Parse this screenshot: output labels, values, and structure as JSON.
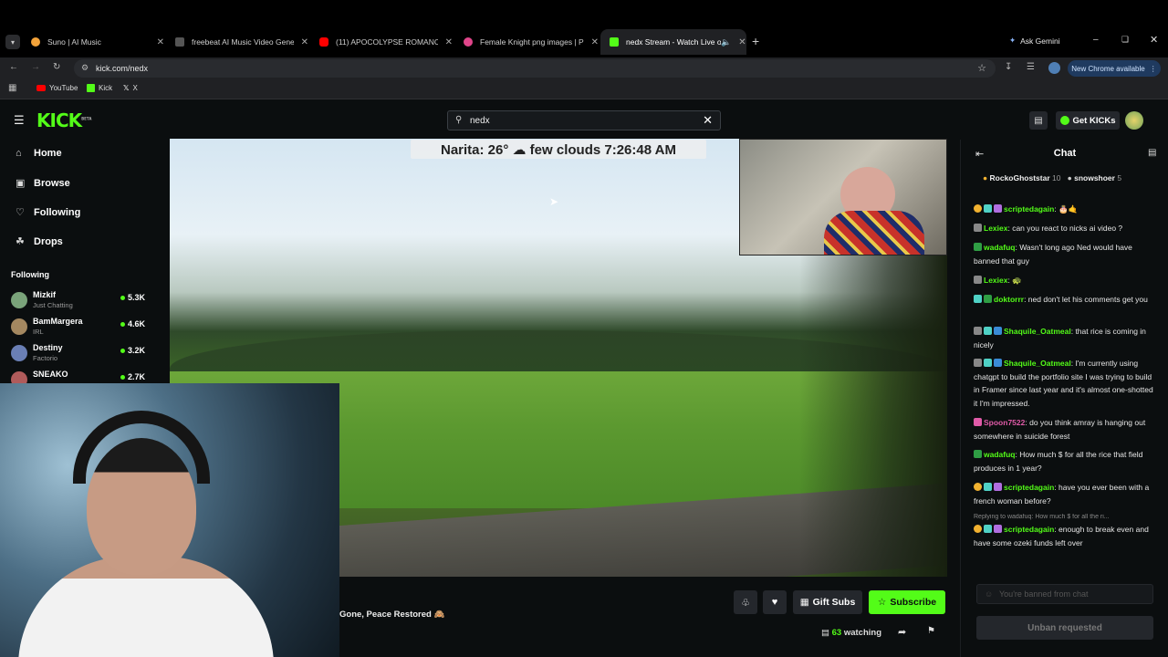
{
  "browser": {
    "tabs": [
      {
        "title": "Suno | AI Music",
        "color": "#f3a33a"
      },
      {
        "title": "freebeat AI Music Video Gener",
        "color": "#444444"
      },
      {
        "title": "(11) APOCOLYPSE ROMANCE -",
        "color": "#ff0000"
      },
      {
        "title": "Female Knight png images | PN",
        "color": "#e0458a"
      },
      {
        "title": "nedx Stream - Watch Live o",
        "color": "#53fc18"
      }
    ],
    "new_tab": "+",
    "ask_gemini": "Ask Gemini",
    "url": "kick.com/nedx",
    "new_chrome": "New Chrome available",
    "bookmarks": [
      "YouTube",
      "Kick",
      "X"
    ]
  },
  "kick": {
    "logo": "KICK",
    "logo_sup": "BETA",
    "search_value": "nedx",
    "get_kicks": "Get KICKs"
  },
  "sidebar": {
    "nav": [
      {
        "label": "Home",
        "icon": "home-icon"
      },
      {
        "label": "Browse",
        "icon": "browse-icon"
      },
      {
        "label": "Following",
        "icon": "heart-icon"
      },
      {
        "label": "Drops",
        "icon": "drops-icon"
      }
    ],
    "following_heading": "Following",
    "following": [
      {
        "name": "Mizkif",
        "category": "Just Chatting",
        "viewers": "5.3K",
        "color": "#7aa37a"
      },
      {
        "name": "BamMargera",
        "category": "IRL",
        "viewers": "4.6K",
        "color": "#a48860"
      },
      {
        "name": "Destiny",
        "category": "Factorio",
        "viewers": "3.2K",
        "color": "#6a7fb5"
      },
      {
        "name": "SNEAKO",
        "category": "",
        "viewers": "2.7K",
        "color": "#b05b5b"
      }
    ]
  },
  "video": {
    "weather": "Narita: 26° ☁ few clouds 7:26:48 AM"
  },
  "stream": {
    "title": "Gone, Peace Restored 🙈",
    "gift_subs": "Gift Subs",
    "subscribe": "Subscribe",
    "watching_count": "63",
    "watching_label": "watching"
  },
  "chat": {
    "title": "Chat",
    "pinned": [
      {
        "user": "RockoGhoststar",
        "count": "10"
      },
      {
        "user": "snowshoer",
        "count": "5"
      }
    ],
    "messages": [
      {
        "user": "scriptedagain",
        "color": "#53fc18",
        "text": ""
      },
      {
        "user": "Lexiex",
        "color": "#53fc18",
        "text": "can you react to nicks ai video ?"
      },
      {
        "user": "wadafuq",
        "color": "#53fc18",
        "text": "Wasn't long ago Ned would have banned that guy"
      },
      {
        "user": "Lexiex",
        "color": "#53fc18",
        "text": ""
      },
      {
        "user": "doktorrr",
        "color": "#53fc18",
        "text": "ned don't let his comments get you"
      },
      {
        "user": "Shaquile_Oatmeal",
        "color": "#53fc18",
        "text": "that rice is coming in nicely"
      },
      {
        "user": "Shaquile_Oatmeal",
        "color": "#53fc18",
        "text": "I'm currently using chatgpt to build the portfolio site I was trying to build in Framer since last year and it's almost one-shotted it I'm impressed."
      },
      {
        "user": "Spoon7522",
        "color": "#e05ba8",
        "text": "do you think amray is hanging out somewhere in suicide forest"
      },
      {
        "user": "wadafuq",
        "color": "#53fc18",
        "text": "How much $ for all the rice that field produces in 1 year?"
      },
      {
        "user": "scriptedagain",
        "color": "#53fc18",
        "text": "have you ever been with a french woman before?"
      },
      {
        "user": "scriptedagain",
        "color": "#53fc18",
        "text": "enough to break even and have some ozeki funds left over"
      }
    ],
    "reply_context": "Replying to wadafuq: How much $ for all the ri...",
    "input_placeholder": "You're banned from chat",
    "unban": "Unban requested"
  }
}
